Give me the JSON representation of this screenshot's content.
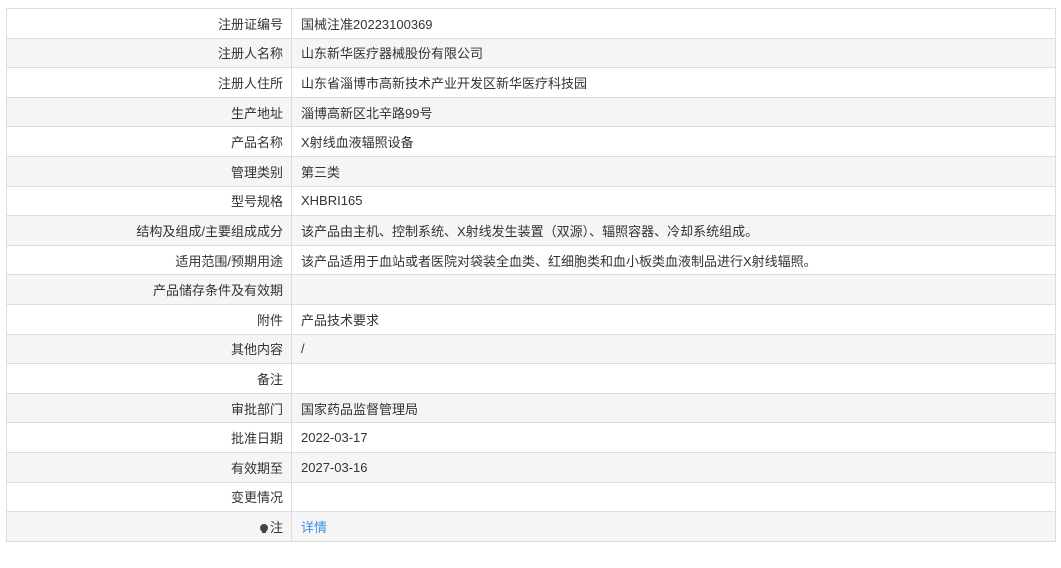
{
  "rows": [
    {
      "label": "注册证编号",
      "value": "国械注准20223100369"
    },
    {
      "label": "注册人名称",
      "value": "山东新华医疗器械股份有限公司"
    },
    {
      "label": "注册人住所",
      "value": "山东省淄博市高新技术产业开发区新华医疗科技园"
    },
    {
      "label": "生产地址",
      "value": "淄博高新区北辛路99号"
    },
    {
      "label": "产品名称",
      "value": "X射线血液辐照设备"
    },
    {
      "label": "管理类别",
      "value": "第三类"
    },
    {
      "label": "型号规格",
      "value": "XHBRI165"
    },
    {
      "label": "结构及组成/主要组成成分",
      "value": "该产品由主机、控制系统、X射线发生装置（双源）、辐照容器、冷却系统组成。"
    },
    {
      "label": "适用范围/预期用途",
      "value": "该产品适用于血站或者医院对袋装全血类、红细胞类和血小板类血液制品进行X射线辐照。"
    },
    {
      "label": "产品储存条件及有效期",
      "value": ""
    },
    {
      "label": "附件",
      "value": "产品技术要求"
    },
    {
      "label": "其他内容",
      "value": "/"
    },
    {
      "label": "备注",
      "value": ""
    },
    {
      "label": "审批部门",
      "value": "国家药品监督管理局"
    },
    {
      "label": "批准日期",
      "value": "2022-03-17"
    },
    {
      "label": "有效期至",
      "value": "2027-03-16"
    },
    {
      "label": "变更情况",
      "value": ""
    },
    {
      "label": "注",
      "value": "详情",
      "icon": "lightbulb-icon",
      "link_color": "#3a8ee6"
    }
  ]
}
